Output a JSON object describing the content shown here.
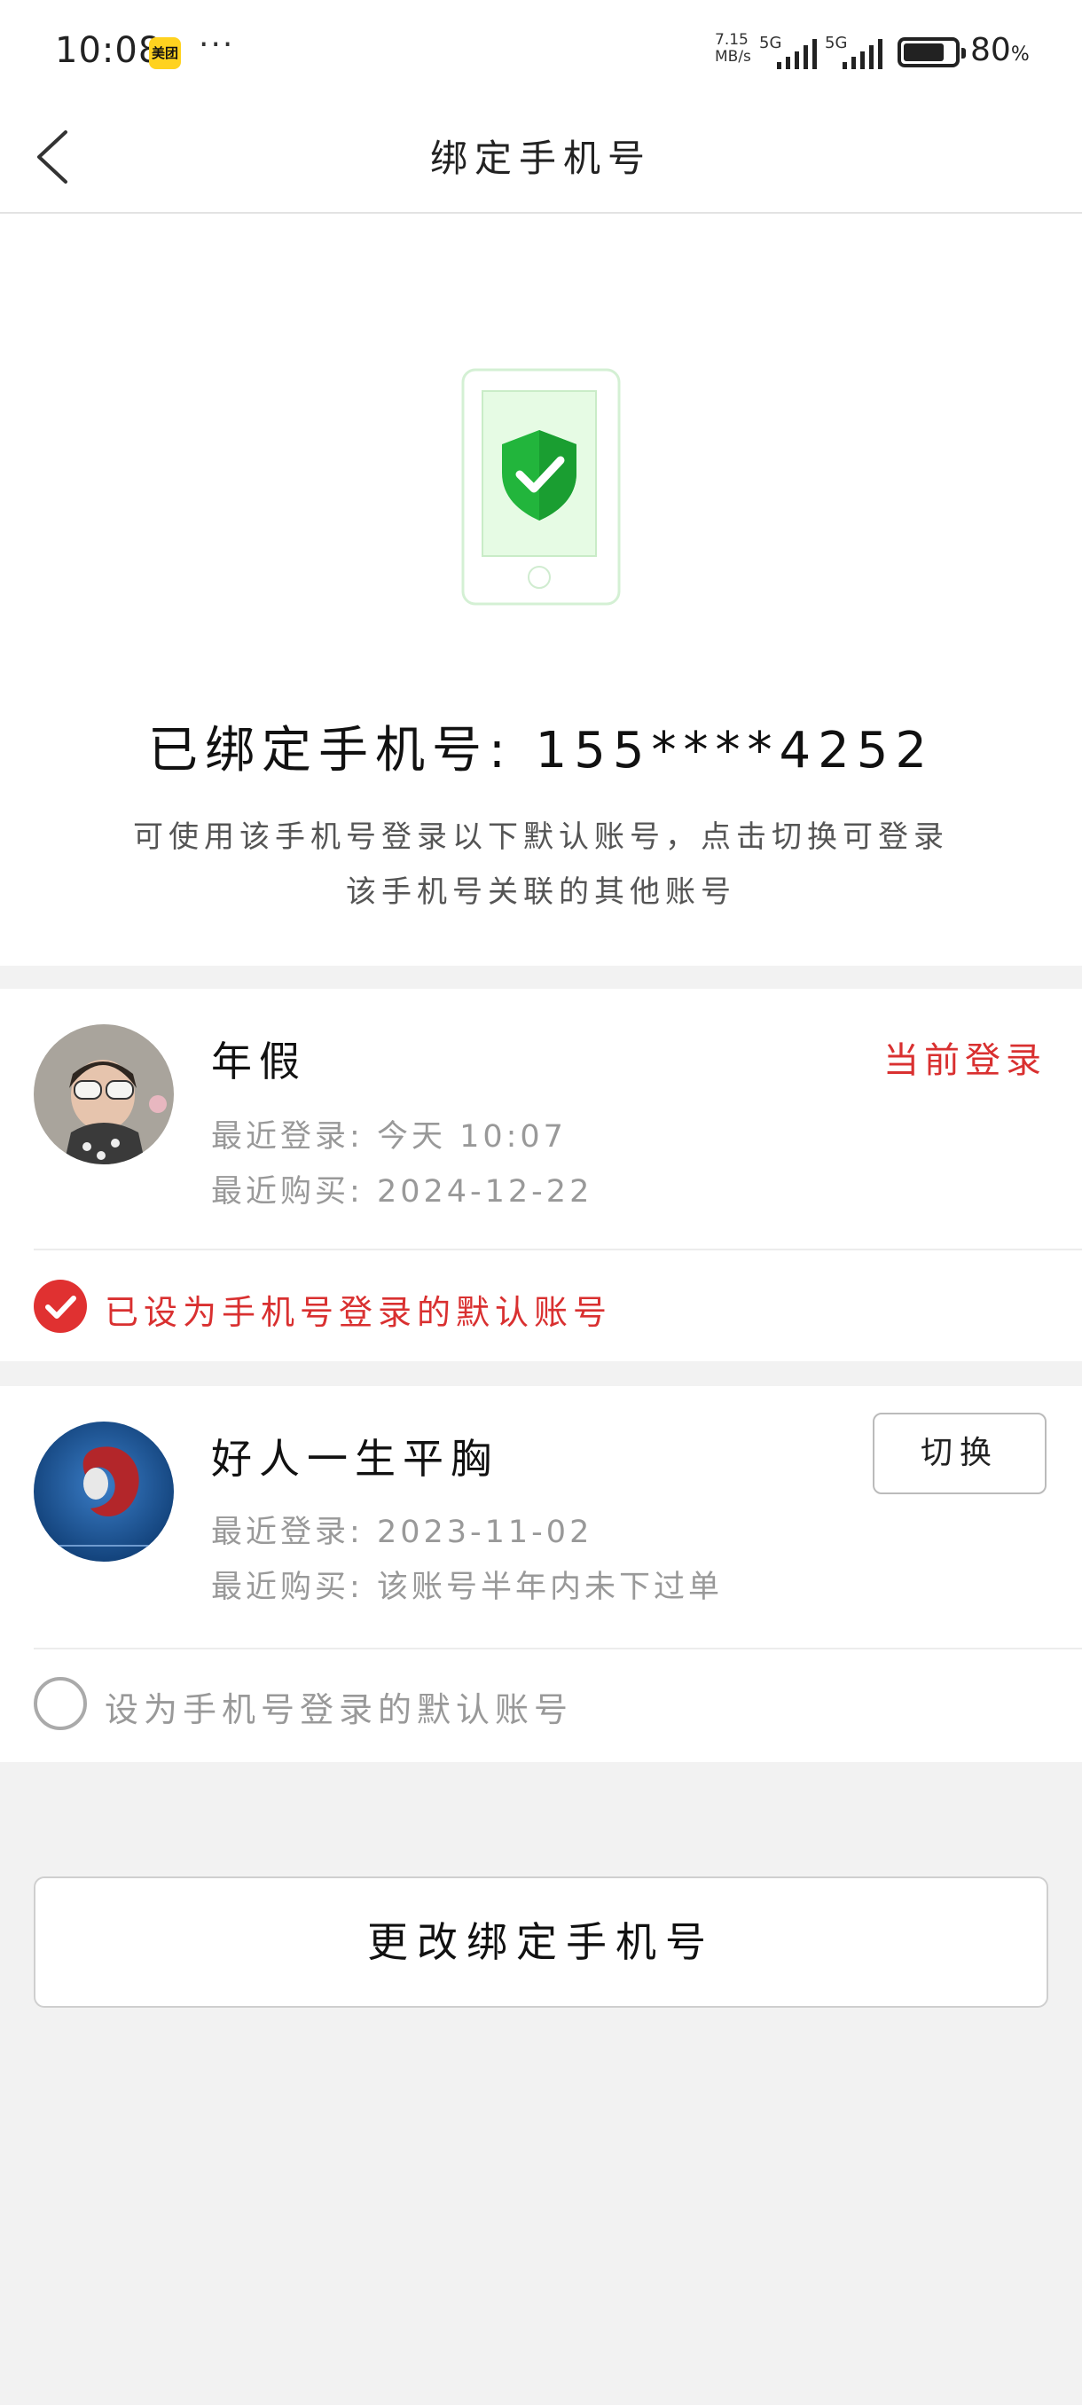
{
  "status_bar": {
    "time": "10:08",
    "app_icon_label": "美团",
    "more": "···",
    "speed_value": "7.15",
    "speed_unit": "MB/s",
    "net1": "5G",
    "net2": "5G",
    "battery_value": "80",
    "battery_unit": "%",
    "battery_level": 0.8
  },
  "header": {
    "title": "绑定手机号"
  },
  "hero": {
    "bound_label": "已绑定手机号:",
    "phone": "155****4252",
    "desc_line1": "可使用该手机号登录以下默认账号，点击切换可登录",
    "desc_line2": "该手机号关联的其他账号",
    "shield_color": "#22b53c"
  },
  "accounts": [
    {
      "name": "年假",
      "status": "当前登录",
      "last_login_label": "最近登录:",
      "last_login": "今天 10:07",
      "last_purchase_label": "最近购买:",
      "last_purchase": "2024-12-22",
      "default_label": "已设为手机号登录的默认账号",
      "is_default": true
    },
    {
      "name": "好人一生平胸",
      "action": "切换",
      "last_login_label": "最近登录:",
      "last_login": "2023-11-02",
      "last_purchase_label": "最近购买:",
      "last_purchase": "该账号半年内未下过单",
      "default_label": "设为手机号登录的默认账号",
      "is_default": false
    }
  ],
  "footer": {
    "change_button": "更改绑定手机号"
  },
  "colors": {
    "accent_red": "#d93030",
    "background": "#f2f2f2"
  }
}
